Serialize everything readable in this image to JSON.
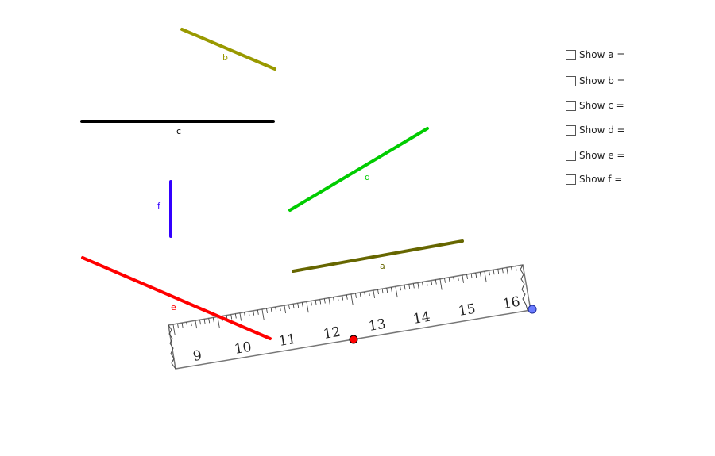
{
  "segments": {
    "a": {
      "label": "a",
      "color": "#666600"
    },
    "b": {
      "label": "b",
      "color": "#999900"
    },
    "c": {
      "label": "c",
      "color": "#000000"
    },
    "d": {
      "label": "d",
      "color": "#00cc00"
    },
    "e": {
      "label": "e",
      "color": "#ff0000"
    },
    "f": {
      "label": "f",
      "color": "#3300ff"
    }
  },
  "ruler": {
    "numbers": [
      "9",
      "10",
      "11",
      "12",
      "13",
      "14",
      "15",
      "16"
    ],
    "handle_colors": {
      "start": "#ff0000",
      "end": "#6b7cff"
    }
  },
  "checkboxes": [
    {
      "label": "Show a =",
      "checked": false
    },
    {
      "label": "Show b =",
      "checked": false
    },
    {
      "label": "Show c =",
      "checked": false
    },
    {
      "label": "Show d =",
      "checked": false
    },
    {
      "label": "Show e =",
      "checked": false
    },
    {
      "label": "Show f =",
      "checked": false
    }
  ]
}
